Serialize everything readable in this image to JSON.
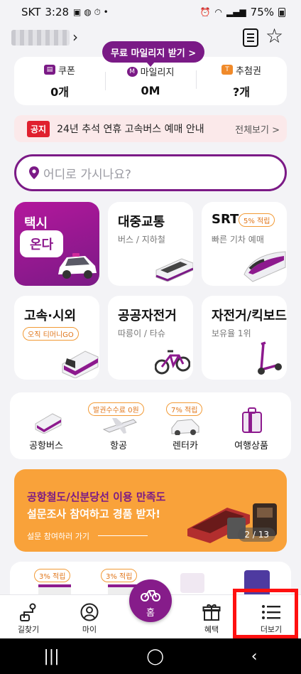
{
  "status_bar": {
    "carrier": "SKT",
    "time": "3:28",
    "battery": "75%"
  },
  "topbar": {
    "mileage_button": "무료 마일리지 받기 >"
  },
  "summary": [
    {
      "label": "쿠폰",
      "value": "0개",
      "color": "#7b1a86"
    },
    {
      "label": "마일리지",
      "value": "0M",
      "color": "#7b1a86"
    },
    {
      "label": "추첨권",
      "value": "?개",
      "color": "#f08a2a"
    }
  ],
  "notice": {
    "badge": "공지",
    "text": "24년 추석 연휴 고속버스 예매 안내",
    "more": "전체보기 >"
  },
  "search": {
    "placeholder": "어디로 가시나요?"
  },
  "cards": {
    "taxi": {
      "title": "택시",
      "brand": "온다"
    },
    "transit": {
      "title": "대중교통",
      "sub": "버스 / 지하철"
    },
    "srt": {
      "title": "SRT",
      "tag": "5% 적립",
      "sub": "빠른 기차 예매"
    },
    "express": {
      "title": "고속·시외",
      "tag": "오직 티머니GO"
    },
    "bike": {
      "title": "공공자전거",
      "sub": "따릉이 / 타슈"
    },
    "scooter": {
      "title": "자전거/킥보드",
      "sub": "보유율 1위"
    }
  },
  "services": [
    {
      "label": "공항버스",
      "tag": ""
    },
    {
      "label": "항공",
      "tag": "발권수수료 0원"
    },
    {
      "label": "렌터카",
      "tag": "7% 적립"
    },
    {
      "label": "여행상품",
      "tag": ""
    }
  ],
  "banner": {
    "line1": "공항철도/신분당선 이용 만족도",
    "line2": "설문조사 참여하고 경품 받자!",
    "cta": "설문 참여하러 가기",
    "page": "2 / 13"
  },
  "promo_tags": [
    "3% 적립",
    "3% 적립"
  ],
  "bottom_nav": {
    "route": "길찾기",
    "my": "마이",
    "home": "홈",
    "benefits": "혜택",
    "more": "더보기"
  }
}
